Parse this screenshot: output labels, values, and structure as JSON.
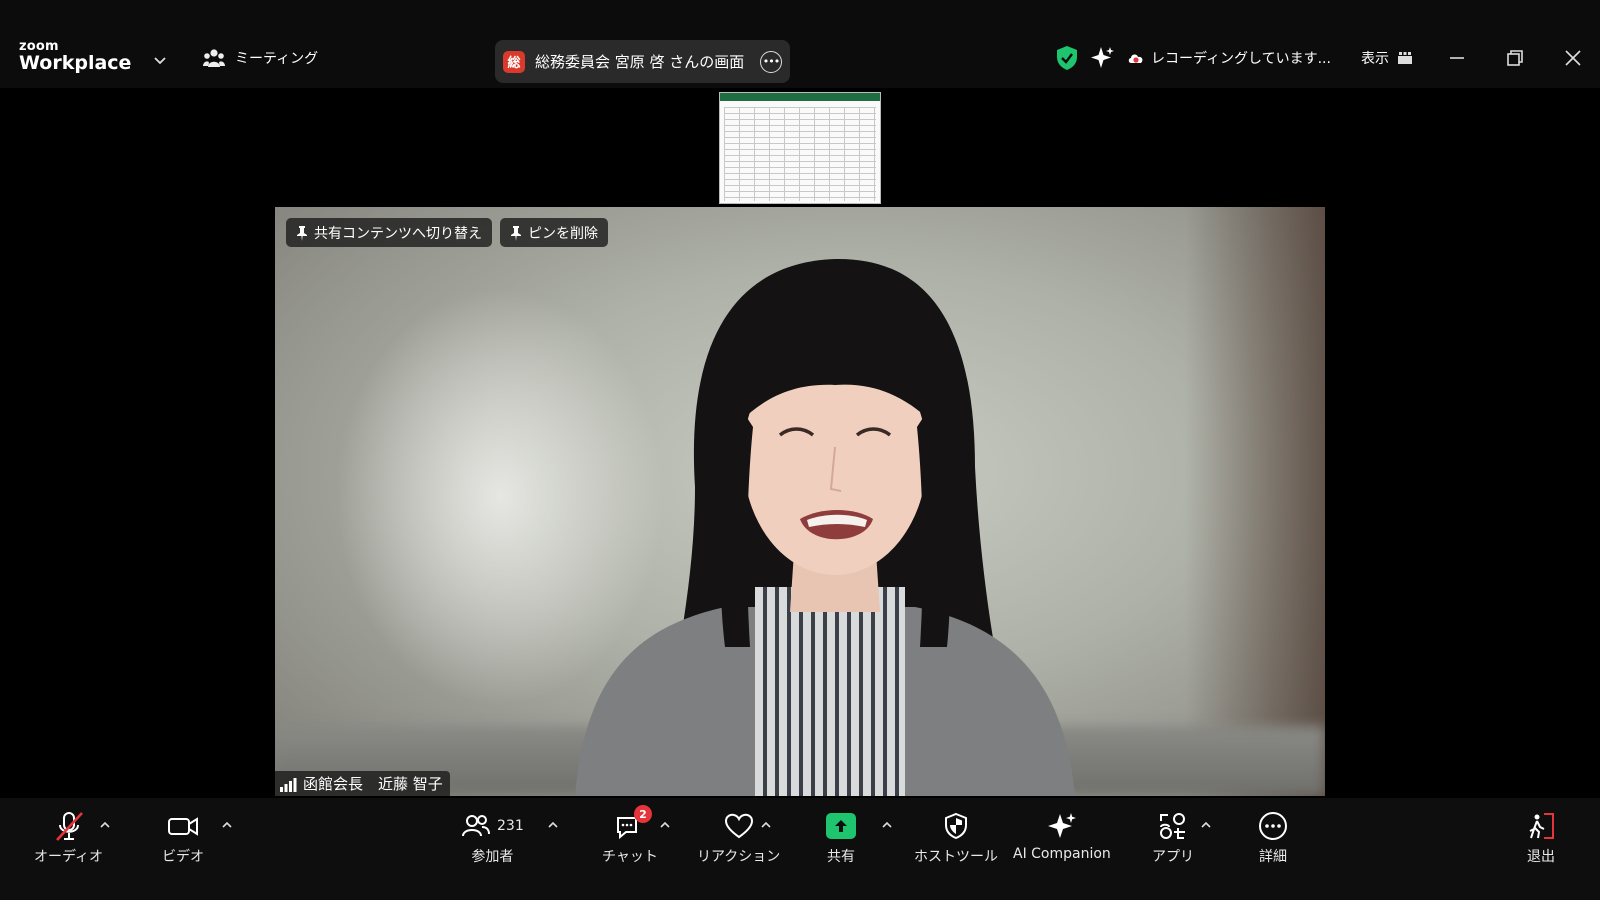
{
  "app": {
    "logo_small": "zoom",
    "logo_large": "Workplace"
  },
  "topbar": {
    "meeting_label": "ミーティング",
    "share_avatar": "総",
    "share_title": "総務委員会 宮原 啓 さんの画面",
    "recording_text": "レコーディングしています...",
    "view_label": "表示"
  },
  "video": {
    "switch_to_share_label": "共有コンテンツへ切り替え",
    "remove_pin_label": "ピンを削除",
    "participant_name": "函館会長　近藤 智子"
  },
  "toolbar": {
    "audio_label": "オーディオ",
    "video_label": "ビデオ",
    "participants_label": "参加者",
    "participants_count": "231",
    "chat_label": "チャット",
    "chat_badge": "2",
    "reactions_label": "リアクション",
    "share_label": "共有",
    "host_tools_label": "ホストツール",
    "ai_companion_label": "AI Companion",
    "apps_label": "アプリ",
    "more_label": "詳細",
    "leave_label": "退出"
  },
  "colors": {
    "accent_green": "#1ec56e",
    "badge_red": "#e5343a",
    "share_avatar_red": "#d93a2b"
  }
}
